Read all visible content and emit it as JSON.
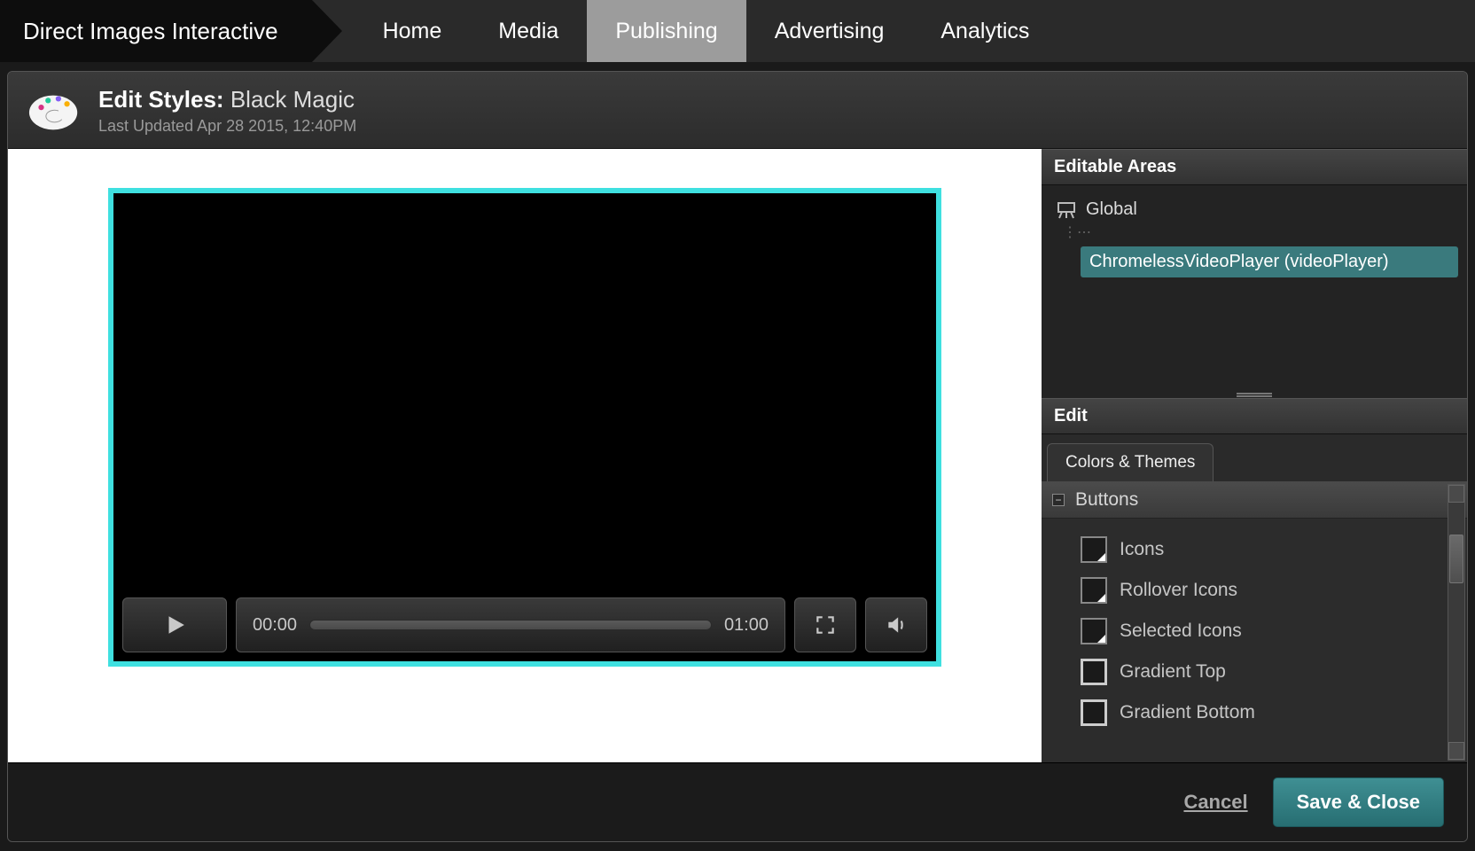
{
  "brand": "Direct Images Interactive",
  "nav": {
    "items": [
      {
        "label": "Home",
        "active": false
      },
      {
        "label": "Media",
        "active": false
      },
      {
        "label": "Publishing",
        "active": true
      },
      {
        "label": "Advertising",
        "active": false
      },
      {
        "label": "Analytics",
        "active": false
      }
    ]
  },
  "header": {
    "title_prefix": "Edit Styles:",
    "style_name": "Black Magic",
    "last_updated": "Last Updated Apr 28 2015, 12:40PM"
  },
  "player": {
    "time_current": "00:00",
    "time_total": "01:00",
    "accent_color": "#3fe0e0"
  },
  "editable_areas": {
    "heading": "Editable Areas",
    "root": "Global",
    "selected": "ChromelessVideoPlayer (videoPlayer)"
  },
  "edit_panel": {
    "heading": "Edit",
    "tab": "Colors & Themes",
    "group": "Buttons",
    "properties": [
      {
        "label": "Icons",
        "swatch": "corner"
      },
      {
        "label": "Rollover Icons",
        "swatch": "corner"
      },
      {
        "label": "Selected Icons",
        "swatch": "corner"
      },
      {
        "label": "Gradient Top",
        "swatch": "fullborder"
      },
      {
        "label": "Gradient Bottom",
        "swatch": "fullborder"
      }
    ]
  },
  "footer": {
    "cancel": "Cancel",
    "save": "Save & Close"
  }
}
